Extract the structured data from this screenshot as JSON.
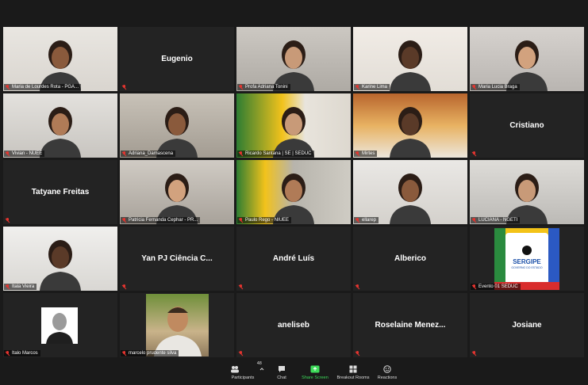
{
  "participants": [
    {
      "label": "Maria de Lourdes Rota - PGA...",
      "center_name": "",
      "kind": "video"
    },
    {
      "label": "",
      "center_name": "Eugenio",
      "kind": "name"
    },
    {
      "label": "Profa Adriana Tonini",
      "center_name": "",
      "kind": "video"
    },
    {
      "label": "Karine Lima",
      "center_name": "",
      "kind": "video"
    },
    {
      "label": "Maria Lucia Braga",
      "center_name": "",
      "kind": "video"
    },
    {
      "label": "Vivian - NUEE",
      "center_name": "",
      "kind": "video"
    },
    {
      "label": "Adriana_Damascena",
      "center_name": "",
      "kind": "video"
    },
    {
      "label": "Ricardo Santana | SE | SEDUC",
      "center_name": "",
      "kind": "video"
    },
    {
      "label": "Mirtes",
      "center_name": "",
      "kind": "video"
    },
    {
      "label": "",
      "center_name": "Cristiano",
      "kind": "name"
    },
    {
      "label": "",
      "center_name": "Tatyane Freitas",
      "kind": "name"
    },
    {
      "label": "Patricia Fernanda Cephar - PR...",
      "center_name": "",
      "kind": "video"
    },
    {
      "label": "Paulo Rego - NIUEE",
      "center_name": "",
      "kind": "video"
    },
    {
      "label": "ellarep",
      "center_name": "",
      "kind": "video"
    },
    {
      "label": "LUCIANA - NGETI",
      "center_name": "",
      "kind": "video"
    },
    {
      "label": "Itala Vieira",
      "center_name": "",
      "kind": "video"
    },
    {
      "label": "",
      "center_name": "Yan PJ Ciência C...",
      "kind": "name"
    },
    {
      "label": "",
      "center_name": "André Luís",
      "kind": "name"
    },
    {
      "label": "",
      "center_name": "Alberico",
      "kind": "name"
    },
    {
      "label": "Evento 01 SEDUC",
      "center_name": "",
      "kind": "logo"
    },
    {
      "label": "Italo Marcos",
      "center_name": "",
      "kind": "photo"
    },
    {
      "label": "marcelo prudente silva",
      "center_name": "",
      "kind": "photo"
    },
    {
      "label": "",
      "center_name": "aneliseb",
      "kind": "name"
    },
    {
      "label": "",
      "center_name": "Roselaine Menez...",
      "kind": "name"
    },
    {
      "label": "",
      "center_name": "Josiane",
      "kind": "name"
    }
  ],
  "speaking_index": 7,
  "logo": {
    "title": "SERGIPE",
    "subtitle": "GOVERNO DO ESTADO",
    "colors": [
      "#f3c318",
      "#2a8a3e",
      "#2b59c3",
      "#d92d2d"
    ]
  },
  "toolbar": {
    "participants_label": "Participants",
    "participants_count": "48",
    "chat_label": "Chat",
    "share_label": "Share Screen",
    "breakout_label": "Breakout Rooms",
    "reactions_label": "Reactions"
  }
}
